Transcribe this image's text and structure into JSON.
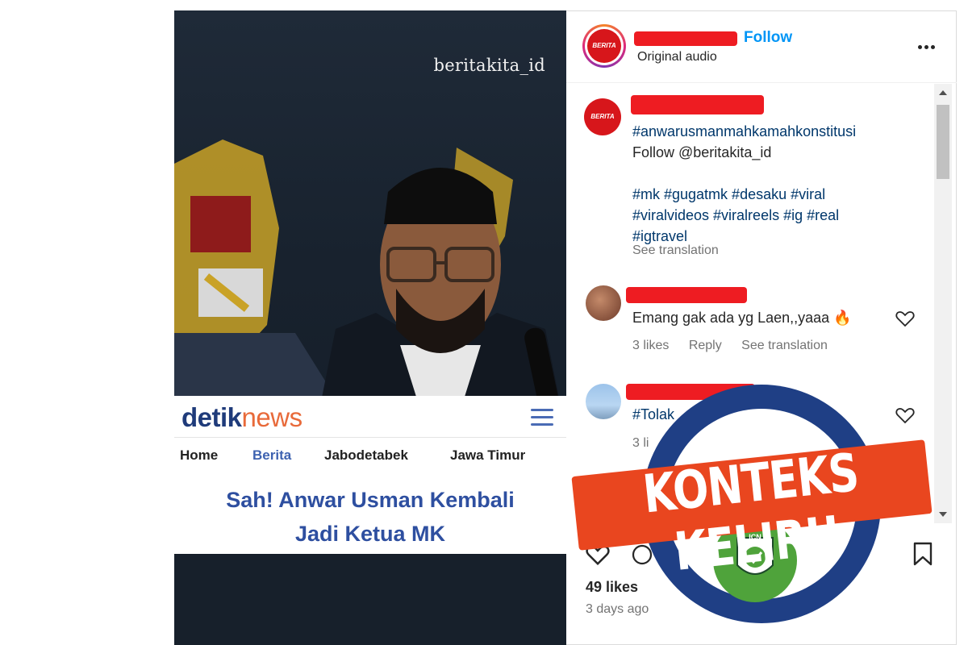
{
  "video": {
    "watermark": "beritakita_id",
    "news_logo_main": "detik",
    "news_logo_sub": "news",
    "nav": [
      "Home",
      "Berita",
      "Jabodetabek",
      "Jawa Timur"
    ],
    "headline_line1": "Sah! Anwar Usman Kembali",
    "headline_line2": "Jadi Ketua MK"
  },
  "post_header": {
    "avatar_text": "BERITA KITA",
    "follow_label": "Follow",
    "audio_label": "Original audio"
  },
  "caption": {
    "avatar_text": "BERITA KITA",
    "lines": [
      "#anwarusmanmahkamahkonstitusi",
      "Follow @beritakita_id",
      "",
      "#mk #gugatmk #desaku #viral",
      "#viralvideos #viralreels #ig #real",
      "#igtravel"
    ],
    "see_translation": "See translation"
  },
  "comments": [
    {
      "text": "Emang gak ada yg Laen,,yaaa 🔥",
      "likes": "3 likes",
      "reply": "Reply",
      "see_translation": "See translation"
    },
    {
      "text": "#Tolak",
      "likes": "3 li"
    }
  ],
  "actions": {
    "likes": "49 likes",
    "time_ago": "3 days ago"
  },
  "stamp": {
    "label": "KONTEKS KELIRU",
    "badge_text": "ICN"
  },
  "colors": {
    "follow_blue": "#0095f6",
    "redaction_red": "#ee1c22",
    "stamp_orange": "#e9461f",
    "stamp_ring_blue": "#1f3f85",
    "badge_green": "#4fa33b"
  }
}
